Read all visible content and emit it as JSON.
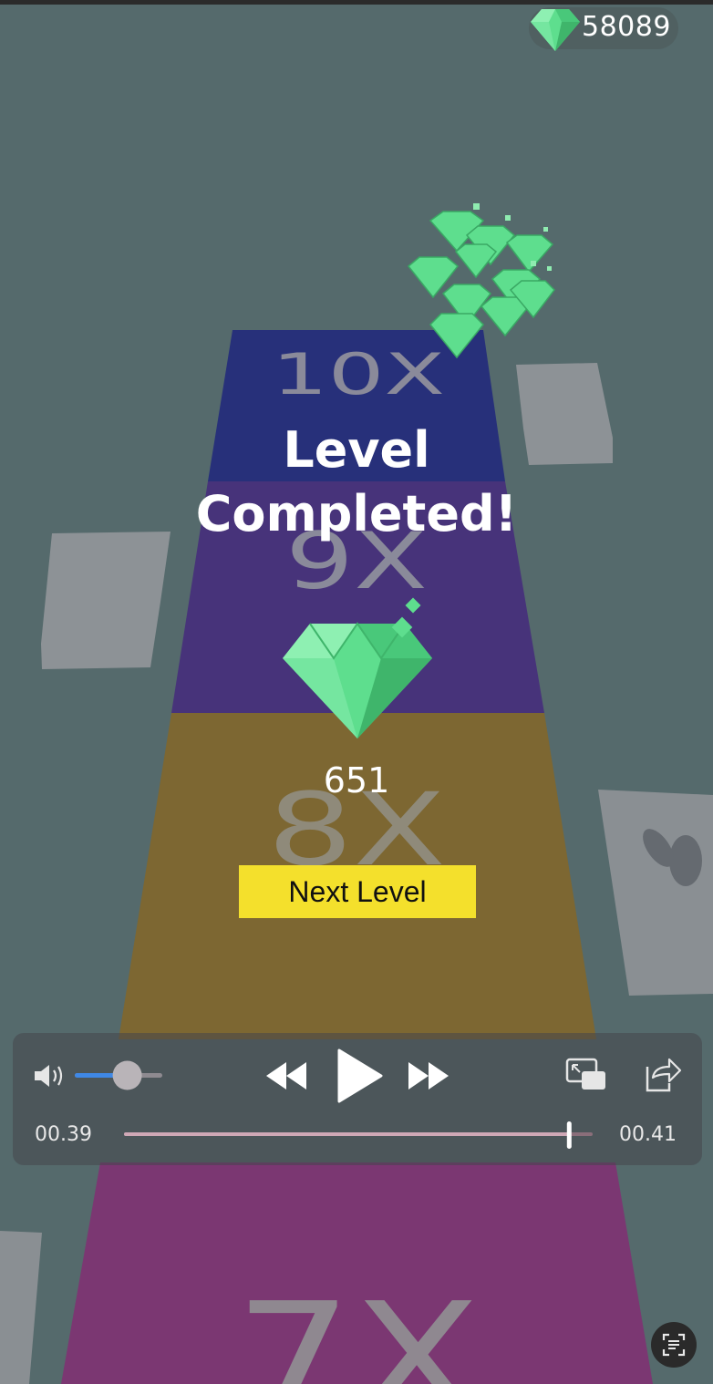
{
  "hud": {
    "gem_count": "58089"
  },
  "track": {
    "multipliers": [
      "10X",
      "9X",
      "8X",
      "7X"
    ]
  },
  "result": {
    "title_line1": "Level",
    "title_line2": "Completed!",
    "reward": "651",
    "next_button": "Next Level"
  },
  "video_player": {
    "current_time": "00.39",
    "end_time": "00.41",
    "volume_level": 0.6,
    "progress": 0.95
  },
  "icons": {
    "gem": "gem-icon",
    "volume": "volume-icon",
    "rewind": "rewind-icon",
    "play": "play-icon",
    "forward": "fast-forward-icon",
    "pip": "picture-in-picture-icon",
    "share": "share-icon",
    "captions": "live-text-icon"
  },
  "colors": {
    "background": "#556a6c",
    "lane_10x": "#27307a",
    "lane_9x": "#47337a",
    "lane_8x": "#7d6732",
    "lane_7x": "#7b3772",
    "gem": "#5ede8e",
    "button": "#f4e02c"
  }
}
